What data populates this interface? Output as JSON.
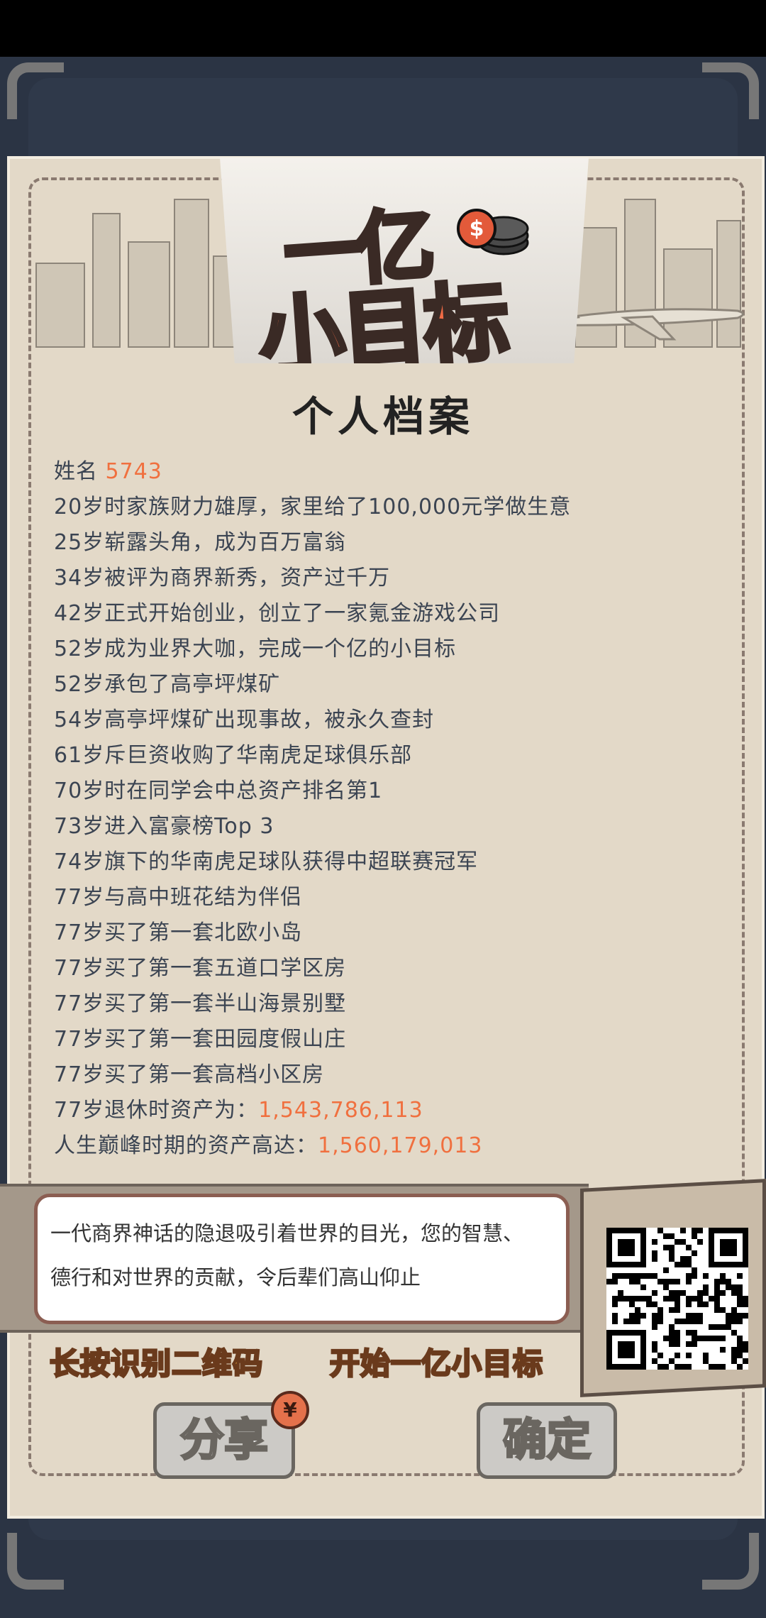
{
  "logo": {
    "line1": "一亿",
    "line2": "小目标"
  },
  "title": "个人档案",
  "profile": {
    "name_label": "姓名",
    "name_value": "5743",
    "events": [
      "20岁时家族财力雄厚，家里给了100,000元学做生意",
      "25岁崭露头角，成为百万富翁",
      "34岁被评为商界新秀，资产过千万",
      "42岁正式开始创业，创立了一家氪金游戏公司",
      "52岁成为业界大咖，完成一个亿的小目标",
      "52岁承包了高亭坪煤矿",
      "54岁高亭坪煤矿出现事故，被永久查封",
      "61岁斥巨资收购了华南虎足球俱乐部",
      "70岁时在同学会中总资产排名第1",
      "73岁进入富豪榜Top 3",
      "74岁旗下的华南虎足球队获得中超联赛冠军",
      "77岁与高中班花结为伴侣",
      "77岁买了第一套北欧小岛",
      "77岁买了第一套五道口学区房",
      "77岁买了第一套半山海景别墅",
      "77岁买了第一套田园度假山庄",
      "77岁买了第一套高档小区房"
    ],
    "retire_label": "77岁退休时资产为：",
    "retire_value": "1,543,786,113",
    "peak_label": "人生巅峰时期的资产高达：",
    "peak_value": "1,560,179,013"
  },
  "message": {
    "line1": "一代商界神话的隐退吸引着世界的目光，您的智慧、",
    "line2": "德行和对世界的贡献，令后辈们高山仰止"
  },
  "cta": {
    "left": "长按识别二维码",
    "right": "开始一亿小目标"
  },
  "buttons": {
    "share": "分享",
    "confirm": "确定",
    "share_badge": "¥"
  },
  "colors": {
    "accent": "#f0703f",
    "paper": "#e3d9c8",
    "frame": "#2b3444"
  },
  "icons": {
    "qr": "qr-code-icon",
    "coins": "coins-icon",
    "plane": "airplane-icon"
  }
}
